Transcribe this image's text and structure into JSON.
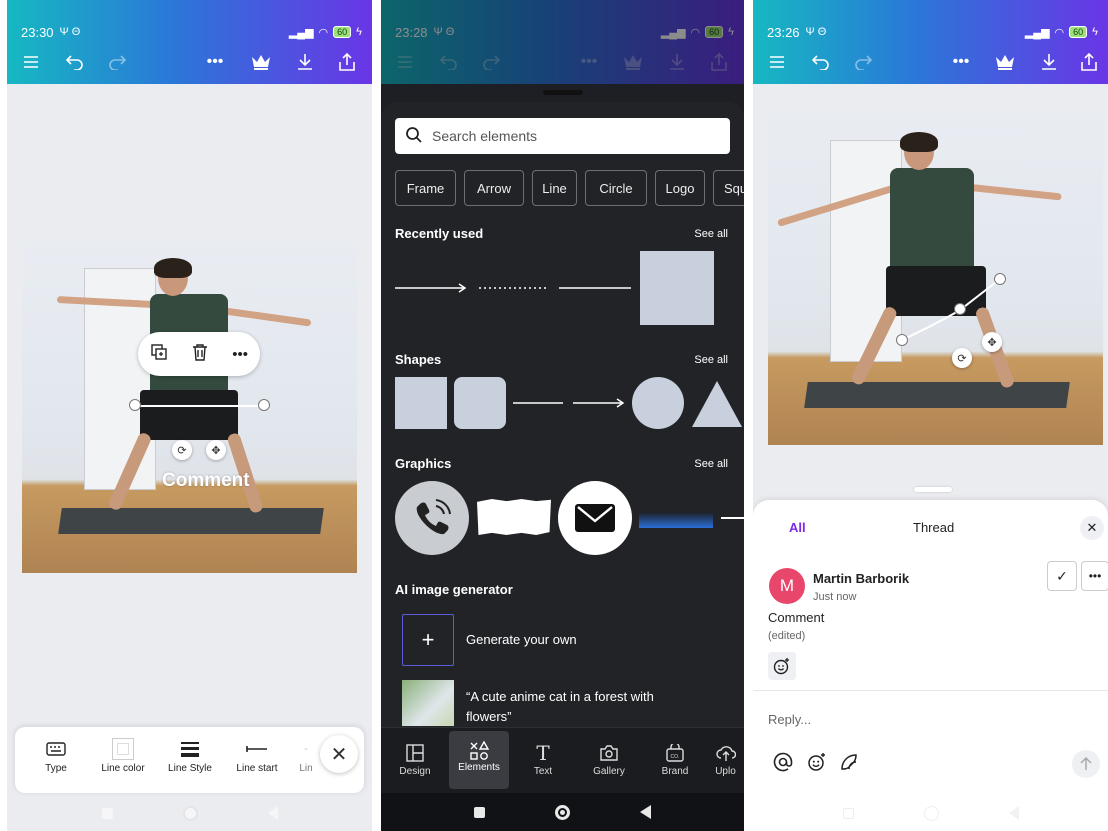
{
  "panel1": {
    "status_time": "23:30",
    "status_icons": "Ψ Θ",
    "battery": "60",
    "canvas_text": "Comment",
    "tray": [
      {
        "label": "Type",
        "icon": "keyboard-icon"
      },
      {
        "label": "Line color",
        "icon": "color-swatch-icon"
      },
      {
        "label": "Line Style",
        "icon": "line-style-icon"
      },
      {
        "label": "Line start",
        "icon": "line-start-icon"
      },
      {
        "label": "Lin",
        "icon": "line-end-icon"
      }
    ]
  },
  "panel2": {
    "status_time": "23:28",
    "status_icons": "Ψ Θ",
    "battery": "60",
    "search_placeholder": "Search elements",
    "chips": [
      "Frame",
      "Arrow",
      "Line",
      "Circle",
      "Logo",
      "Squ"
    ],
    "recently_used": "Recently used",
    "shapes": "Shapes",
    "graphics": "Graphics",
    "see_all": "See all",
    "ai_title": "AI image generator",
    "generate": "Generate your own",
    "cat_prompt": "“A cute anime cat in a forest with flowers”",
    "tabs": [
      {
        "label": "Design",
        "icon": "design-icon"
      },
      {
        "label": "Elements",
        "icon": "elements-icon"
      },
      {
        "label": "Text",
        "icon": "text-icon"
      },
      {
        "label": "Gallery",
        "icon": "gallery-icon"
      },
      {
        "label": "Brand",
        "icon": "brand-icon"
      },
      {
        "label": "Uplo",
        "icon": "upload-icon"
      }
    ]
  },
  "panel3": {
    "status_time": "23:26",
    "status_icons": "Ψ Θ",
    "battery": "60",
    "tab_all": "All",
    "tab_thread": "Thread",
    "avatar_letter": "M",
    "author": "Martin Barborik",
    "time": "Just now",
    "comment": "Comment",
    "edited": "(edited)",
    "reply_placeholder": "Reply..."
  },
  "colors": {
    "accent_purple": "#7d2ae8",
    "avatar": "#e8466a",
    "dark_sheet": "#222327"
  }
}
